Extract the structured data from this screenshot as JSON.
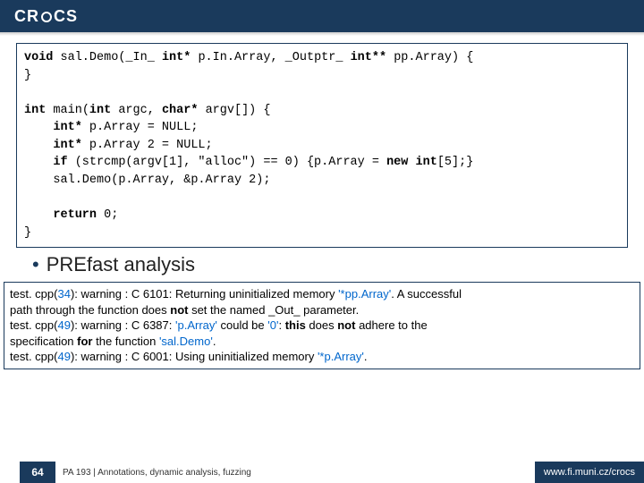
{
  "header": {
    "logo": "CR   CS"
  },
  "code": {
    "l1a": "void",
    "l1b": " sal.Demo(_In_ ",
    "l1c": "int*",
    "l1d": " p.In.Array, _Outptr_ ",
    "l1e": "int**",
    "l1f": " pp.Array) {",
    "l2": "}",
    "l3": "",
    "l4a": "int",
    "l4b": " main(",
    "l4c": "int",
    "l4d": " argc, ",
    "l4e": "char*",
    "l4f": " argv[]) {",
    "l5a": "    ",
    "l5b": "int*",
    "l5c": " p.Array = NULL;",
    "l6a": "    ",
    "l6b": "int*",
    "l6c": " p.Array 2 = NULL;",
    "l7a": "    ",
    "l7b": "if",
    "l7c": " (strcmp(argv[1], \"alloc\") == 0) {p.Array = ",
    "l7d": "new",
    "l7e": " ",
    "l7f": "int",
    "l7g": "[5];}",
    "l8": "    sal.Demo(p.Array, &p.Array 2);",
    "l9": "",
    "l10a": "    ",
    "l10b": "return",
    "l10c": " 0;",
    "l11": "}"
  },
  "bullet": {
    "text": "PREfast analysis"
  },
  "warnings": {
    "w1p": "test. cpp(",
    "w1n": "34",
    "w1a": "): warning : C 6101: Returning uninitialized memory ",
    "w1s": "'*pp.Array'",
    "w1b": ". A successful",
    "w1c": "   path through the function does ",
    "w1d": "not",
    "w1e": " set the named _Out_ parameter.",
    "w2p": "test. cpp(",
    "w2n": "49",
    "w2a": "): warning : C 6387: ",
    "w2s": "'p.Array'",
    "w2b": " could be ",
    "w2s2": "'0'",
    "w2c": ":  ",
    "w2d": "this",
    "w2e": " does ",
    "w2f": "not",
    "w2g": " adhere to the",
    "w2h": "   specification ",
    "w2i": "for",
    "w2j": " the function ",
    "w2s3": "'sal.Demo'",
    "w2k": ".",
    "w3p": "test. cpp(",
    "w3n": "49",
    "w3a": "): warning : C 6001: Using uninitialized memory ",
    "w3s": "'*p.Array'",
    "w3b": "."
  },
  "footer": {
    "page": "64",
    "text": "PA 193 | Annotations, dynamic analysis, fuzzing",
    "right": "www.fi.muni.cz/crocs"
  }
}
